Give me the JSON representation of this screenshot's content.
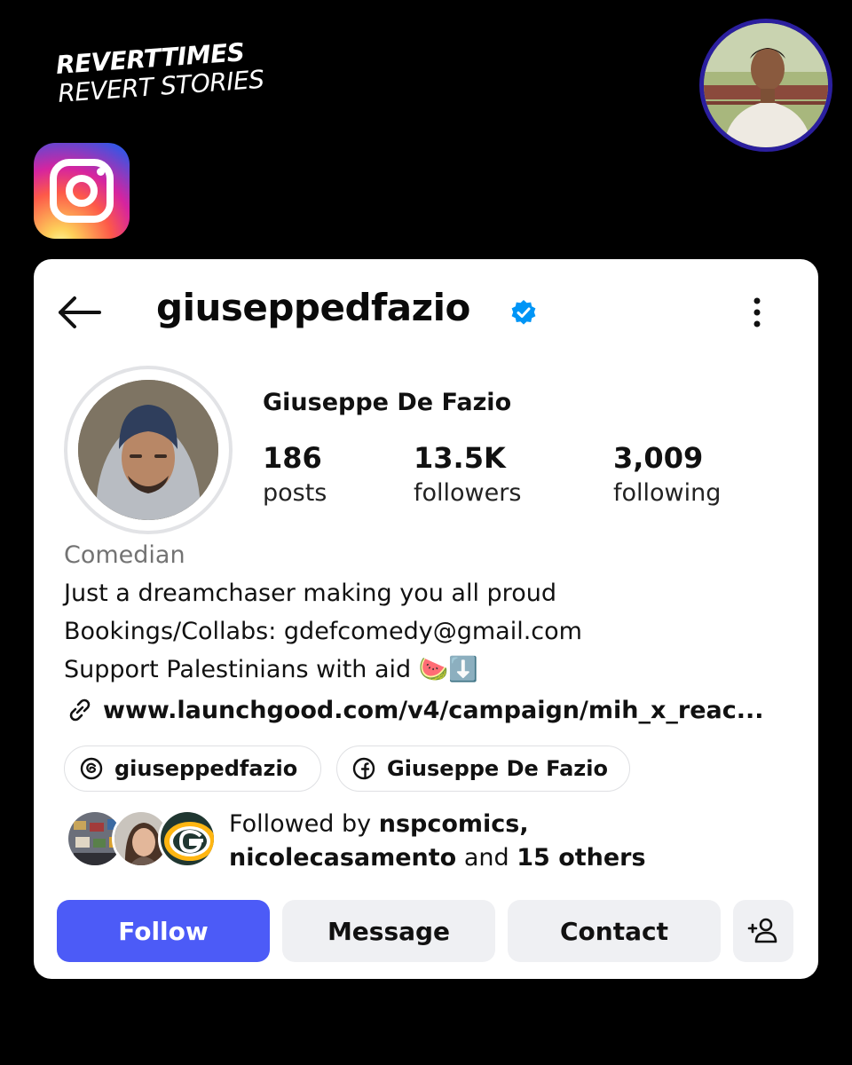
{
  "brand": {
    "line1": "REVERTTIMES",
    "line2": "REVERT STORIES"
  },
  "icons": {
    "instagram": "instagram-logo-icon",
    "back": "arrow-left-icon",
    "verified": "verified-badge-icon",
    "more": "more-vertical-icon",
    "link": "link-icon",
    "threads": "threads-icon",
    "facebook": "facebook-icon",
    "add_person": "add-person-icon"
  },
  "colors": {
    "follow_button": "#4c5bf7",
    "verified": "#0095f6",
    "author_ring": "#2b1f9e"
  },
  "profile": {
    "username": "giuseppedfazio",
    "display_name": "Giuseppe De Fazio",
    "stats": {
      "posts": {
        "count": "186",
        "label": "posts"
      },
      "followers": {
        "count": "13.5K",
        "label": "followers"
      },
      "following": {
        "count": "3,009",
        "label": "following"
      }
    },
    "category": "Comedian",
    "bio": [
      "Just a dreamchaser making you all proud",
      "Bookings/Collabs: gdefcomedy@gmail.com",
      "Support Palestinians with aid 🍉⬇️"
    ],
    "link": "www.launchgood.com/v4/campaign/mih_x_reac...",
    "threads_handle": "giuseppedfazio",
    "facebook_name": "Giuseppe De Fazio",
    "followed_by": {
      "prefix": "Followed by ",
      "user1": "nspcomics,",
      "user2": "nicolecasamento",
      "joiner": " and ",
      "others": "15 others"
    }
  },
  "actions": {
    "follow": "Follow",
    "message": "Message",
    "contact": "Contact"
  }
}
